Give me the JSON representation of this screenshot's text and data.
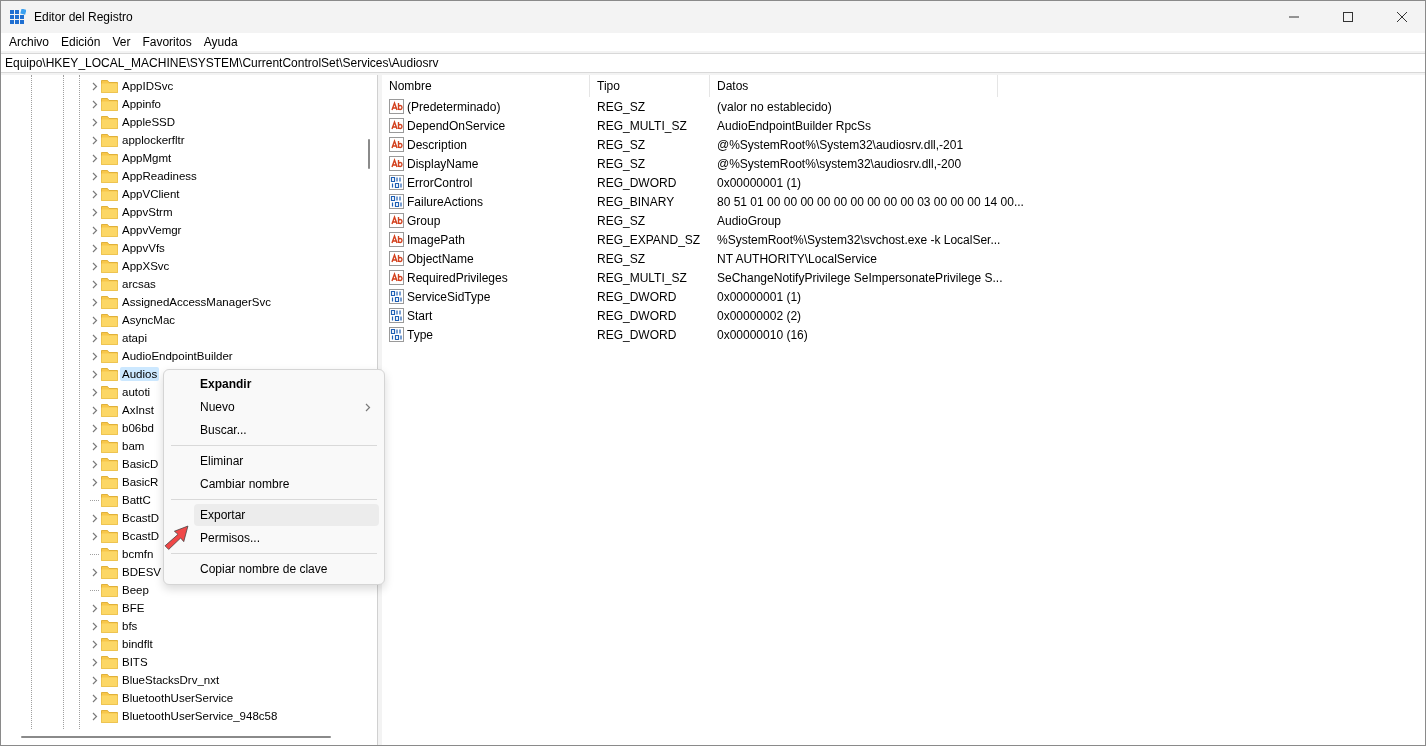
{
  "window": {
    "title": "Editor del Registro"
  },
  "menu_bar": [
    "Archivo",
    "Edición",
    "Ver",
    "Favoritos",
    "Ayuda"
  ],
  "address": "Equipo\\HKEY_LOCAL_MACHINE\\SYSTEM\\CurrentControlSet\\Services\\Audiosrv",
  "tree": [
    {
      "label": "AppIDSvc",
      "expandable": true,
      "selected": false
    },
    {
      "label": "Appinfo",
      "expandable": true,
      "selected": false
    },
    {
      "label": "AppleSSD",
      "expandable": true,
      "selected": false
    },
    {
      "label": "applockerfltr",
      "expandable": true,
      "selected": false
    },
    {
      "label": "AppMgmt",
      "expandable": true,
      "selected": false
    },
    {
      "label": "AppReadiness",
      "expandable": true,
      "selected": false
    },
    {
      "label": "AppVClient",
      "expandable": true,
      "selected": false
    },
    {
      "label": "AppvStrm",
      "expandable": true,
      "selected": false
    },
    {
      "label": "AppvVemgr",
      "expandable": true,
      "selected": false
    },
    {
      "label": "AppvVfs",
      "expandable": true,
      "selected": false
    },
    {
      "label": "AppXSvc",
      "expandable": true,
      "selected": false
    },
    {
      "label": "arcsas",
      "expandable": true,
      "selected": false
    },
    {
      "label": "AssignedAccessManagerSvc",
      "expandable": true,
      "selected": false
    },
    {
      "label": "AsyncMac",
      "expandable": true,
      "selected": false
    },
    {
      "label": "atapi",
      "expandable": true,
      "selected": false
    },
    {
      "label": "AudioEndpointBuilder",
      "expandable": true,
      "selected": false
    },
    {
      "label": "Audios",
      "expandable": true,
      "selected": true
    },
    {
      "label": "autoti",
      "expandable": true,
      "selected": false
    },
    {
      "label": "AxInst",
      "expandable": true,
      "selected": false
    },
    {
      "label": "b06bd",
      "expandable": true,
      "selected": false
    },
    {
      "label": "bam",
      "expandable": true,
      "selected": false
    },
    {
      "label": "BasicD",
      "expandable": true,
      "selected": false
    },
    {
      "label": "BasicR",
      "expandable": true,
      "selected": false
    },
    {
      "label": "BattC",
      "expandable": false,
      "selected": false
    },
    {
      "label": "BcastD",
      "expandable": true,
      "selected": false
    },
    {
      "label": "BcastD",
      "expandable": true,
      "selected": false
    },
    {
      "label": "bcmfn",
      "expandable": false,
      "selected": false
    },
    {
      "label": "BDESV",
      "expandable": true,
      "selected": false
    },
    {
      "label": "Beep",
      "expandable": false,
      "selected": false
    },
    {
      "label": "BFE",
      "expandable": true,
      "selected": false
    },
    {
      "label": "bfs",
      "expandable": true,
      "selected": false
    },
    {
      "label": "bindflt",
      "expandable": true,
      "selected": false
    },
    {
      "label": "BITS",
      "expandable": true,
      "selected": false
    },
    {
      "label": "BlueStacksDrv_nxt",
      "expandable": true,
      "selected": false
    },
    {
      "label": "BluetoothUserService",
      "expandable": true,
      "selected": false
    },
    {
      "label": "BluetoothUserService_948c58",
      "expandable": true,
      "selected": false
    }
  ],
  "values": {
    "columns": [
      "Nombre",
      "Tipo",
      "Datos"
    ],
    "rows": [
      {
        "kind": "string",
        "name": "(Predeterminado)",
        "type": "REG_SZ",
        "data": "(valor no establecido)"
      },
      {
        "kind": "string",
        "name": "DependOnService",
        "type": "REG_MULTI_SZ",
        "data": "AudioEndpointBuilder RpcSs"
      },
      {
        "kind": "string",
        "name": "Description",
        "type": "REG_SZ",
        "data": "@%SystemRoot%\\System32\\audiosrv.dll,-201"
      },
      {
        "kind": "string",
        "name": "DisplayName",
        "type": "REG_SZ",
        "data": "@%SystemRoot%\\system32\\audiosrv.dll,-200"
      },
      {
        "kind": "binary",
        "name": "ErrorControl",
        "type": "REG_DWORD",
        "data": "0x00000001 (1)"
      },
      {
        "kind": "binary",
        "name": "FailureActions",
        "type": "REG_BINARY",
        "data": "80 51 01 00 00 00 00 00 00 00 00 00 03 00 00 00 14 00..."
      },
      {
        "kind": "string",
        "name": "Group",
        "type": "REG_SZ",
        "data": "AudioGroup"
      },
      {
        "kind": "string",
        "name": "ImagePath",
        "type": "REG_EXPAND_SZ",
        "data": "%SystemRoot%\\System32\\svchost.exe -k LocalSer..."
      },
      {
        "kind": "string",
        "name": "ObjectName",
        "type": "REG_SZ",
        "data": "NT AUTHORITY\\LocalService"
      },
      {
        "kind": "string",
        "name": "RequiredPrivileges",
        "type": "REG_MULTI_SZ",
        "data": "SeChangeNotifyPrivilege SeImpersonatePrivilege S..."
      },
      {
        "kind": "binary",
        "name": "ServiceSidType",
        "type": "REG_DWORD",
        "data": "0x00000001 (1)"
      },
      {
        "kind": "binary",
        "name": "Start",
        "type": "REG_DWORD",
        "data": "0x00000002 (2)"
      },
      {
        "kind": "binary",
        "name": "Type",
        "type": "REG_DWORD",
        "data": "0x00000010 (16)"
      }
    ]
  },
  "context_menu": [
    {
      "kind": "item",
      "label": "Expandir",
      "bold": true,
      "submenu": false,
      "highlighted": false
    },
    {
      "kind": "item",
      "label": "Nuevo",
      "bold": false,
      "submenu": true,
      "highlighted": false
    },
    {
      "kind": "item",
      "label": "Buscar...",
      "bold": false,
      "submenu": false,
      "highlighted": false
    },
    {
      "kind": "separator"
    },
    {
      "kind": "item",
      "label": "Eliminar",
      "bold": false,
      "submenu": false,
      "highlighted": false
    },
    {
      "kind": "item",
      "label": "Cambiar nombre",
      "bold": false,
      "submenu": false,
      "highlighted": false
    },
    {
      "kind": "separator"
    },
    {
      "kind": "item",
      "label": "Exportar",
      "bold": false,
      "submenu": false,
      "highlighted": true
    },
    {
      "kind": "item",
      "label": "Permisos...",
      "bold": false,
      "submenu": false,
      "highlighted": false
    },
    {
      "kind": "separator"
    },
    {
      "kind": "item",
      "label": "Copiar nombre de clave",
      "bold": false,
      "submenu": false,
      "highlighted": false
    }
  ]
}
